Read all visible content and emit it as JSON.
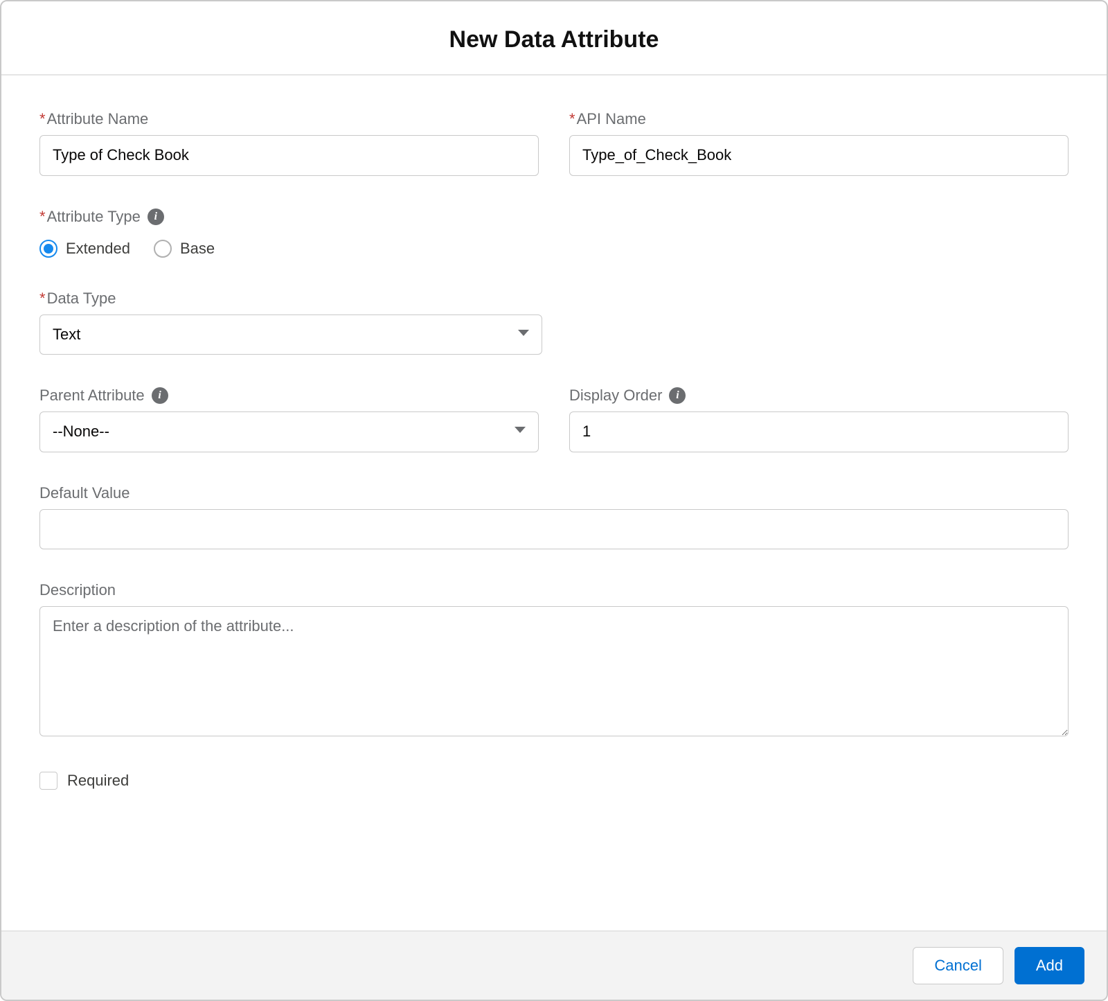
{
  "header": {
    "title": "New Data Attribute"
  },
  "fields": {
    "attribute_name": {
      "label": "Attribute Name",
      "value": "Type of Check Book"
    },
    "api_name": {
      "label": "API Name",
      "value": "Type_of_Check_Book"
    },
    "attribute_type": {
      "label": "Attribute Type",
      "options": {
        "extended": "Extended",
        "base": "Base"
      },
      "selected": "extended"
    },
    "data_type": {
      "label": "Data Type",
      "value": "Text"
    },
    "parent_attribute": {
      "label": "Parent Attribute",
      "value": "--None--"
    },
    "display_order": {
      "label": "Display Order",
      "value": "1"
    },
    "default_value": {
      "label": "Default Value",
      "value": ""
    },
    "description": {
      "label": "Description",
      "placeholder": "Enter a description of the attribute...",
      "value": ""
    },
    "required": {
      "label": "Required",
      "checked": false
    }
  },
  "footer": {
    "cancel": "Cancel",
    "add": "Add"
  }
}
